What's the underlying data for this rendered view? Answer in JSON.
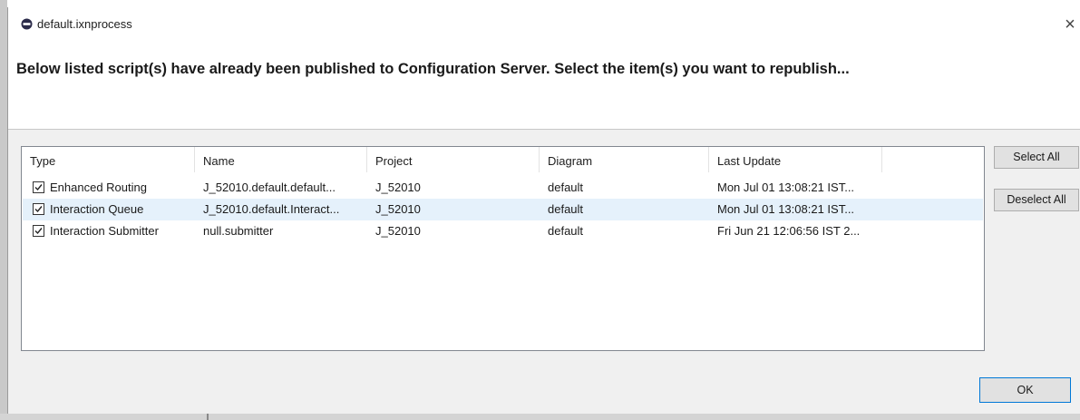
{
  "window": {
    "title": "default.ixnprocess",
    "close_glyph": "×",
    "icon": "app-circle-icon"
  },
  "message": "Below listed script(s) have already been published to Configuration Server. Select the item(s) you want to republish...",
  "table": {
    "columns": [
      "Type",
      "Name",
      "Project",
      "Diagram",
      "Last Update"
    ],
    "rows": [
      {
        "checked": true,
        "type": "Enhanced Routing",
        "name": "J_52010.default.default...",
        "project": "J_52010",
        "diagram": "default",
        "last_update": "Mon Jul 01 13:08:21 IST..."
      },
      {
        "checked": true,
        "type": "Interaction Queue",
        "name": "J_52010.default.Interact...",
        "project": "J_52010",
        "diagram": "default",
        "last_update": "Mon Jul 01 13:08:21 IST..."
      },
      {
        "checked": true,
        "type": "Interaction Submitter",
        "name": "null.submitter",
        "project": "J_52010",
        "diagram": "default",
        "last_update": "Fri Jun 21 12:06:56 IST 2..."
      }
    ],
    "selected_row": 1
  },
  "buttons": {
    "select_all": "Select All",
    "deselect_all": "Deselect All",
    "ok": "OK"
  },
  "colors": {
    "selection": "#e5f1fb",
    "ok_border": "#0078d7",
    "content_bg": "#f0f0f0"
  }
}
